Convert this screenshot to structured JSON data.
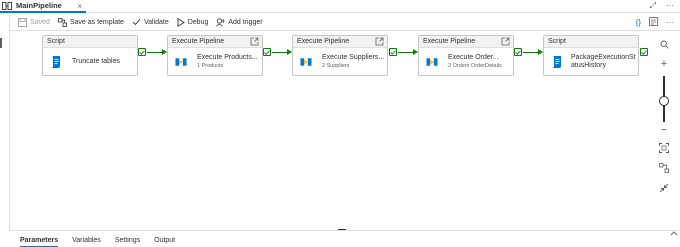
{
  "tab": {
    "title": "MainPipeline",
    "close": "×"
  },
  "window_controls": {
    "expand": "⤢",
    "more": "···"
  },
  "toolbar": {
    "saved": "Saved",
    "save_as_template": "Save as template",
    "validate": "Validate",
    "debug": "Debug",
    "add_trigger": "Add trigger",
    "code_icon": "{}",
    "more": "···"
  },
  "activities": [
    {
      "type": "Script",
      "label": "Truncate tables",
      "sub": "",
      "icon": "script-icon",
      "external_link": false
    },
    {
      "type": "Execute Pipeline",
      "label": "Execute Products...",
      "sub": "1 Products",
      "icon": "execute-pipeline-icon",
      "external_link": true
    },
    {
      "type": "Execute Pipeline",
      "label": "Execute Suppliers...",
      "sub": "2 Suppliers",
      "icon": "execute-pipeline-icon",
      "external_link": true
    },
    {
      "type": "Execute Pipeline",
      "label": "Execute Order...",
      "sub": "3 Orders OrderDetails",
      "icon": "execute-pipeline-icon",
      "external_link": true
    },
    {
      "type": "Script",
      "label": "PackageExecutionSt atusHistory",
      "sub": "",
      "icon": "script-icon",
      "external_link": false
    }
  ],
  "bottom_tabs": [
    {
      "label": "Parameters",
      "active": true
    },
    {
      "label": "Variables",
      "active": false
    },
    {
      "label": "Settings",
      "active": false
    },
    {
      "label": "Output",
      "active": false
    }
  ],
  "colors": {
    "accent": "#0078d4",
    "success": "#107c10",
    "node_border": "#c8c6c4",
    "script_icon": "#0078d4",
    "pipeline_icon": "#0078d4",
    "pipeline_icon_secondary": "#ffb900"
  }
}
